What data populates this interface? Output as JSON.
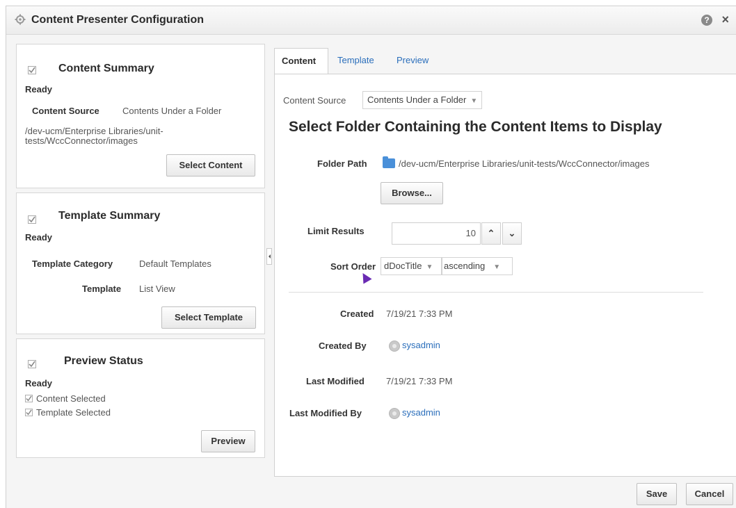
{
  "dialog": {
    "title": "Content Presenter Configuration",
    "help_icon": "?",
    "close_icon": "×"
  },
  "content_summary": {
    "title": "Content Summary",
    "status": "Ready",
    "source_label": "Content Source",
    "source_value": "Contents Under a Folder",
    "path": "/dev-ucm/Enterprise Libraries/unit-tests/WccConnector/images",
    "button": "Select Content"
  },
  "template_summary": {
    "title": "Template Summary",
    "status": "Ready",
    "category_label": "Template Category",
    "category_value": "Default Templates",
    "template_label": "Template",
    "template_value": "List View",
    "button": "Select Template"
  },
  "preview_status": {
    "title": "Preview Status",
    "status": "Ready",
    "items": [
      "Content Selected",
      "Template Selected"
    ],
    "button": "Preview"
  },
  "tabs": [
    "Content",
    "Template",
    "Preview"
  ],
  "content_tab": {
    "source_label": "Content Source",
    "source_select": "Contents Under a Folder",
    "heading": "Select Folder Containing the Content Items to Display",
    "folder_label": "Folder Path",
    "folder_path": "/dev-ucm/Enterprise Libraries/unit-tests/WccConnector/images",
    "browse_button": "Browse...",
    "limit_label": "Limit Results",
    "limit_value": "10",
    "sort_label": "Sort Order",
    "sort_field": "dDocTitle",
    "sort_direction": "ascending",
    "created_label": "Created",
    "created_value": "7/19/21 7:33 PM",
    "created_by_label": "Created By",
    "created_by_value": "sysadmin",
    "modified_label": "Last Modified",
    "modified_value": "7/19/21 7:33 PM",
    "modified_by_label": "Last Modified By",
    "modified_by_value": "sysadmin"
  },
  "footer": {
    "save": "Save",
    "cancel": "Cancel"
  },
  "colors": {
    "link": "#2a6ebb",
    "folder": "#4a90d9"
  }
}
